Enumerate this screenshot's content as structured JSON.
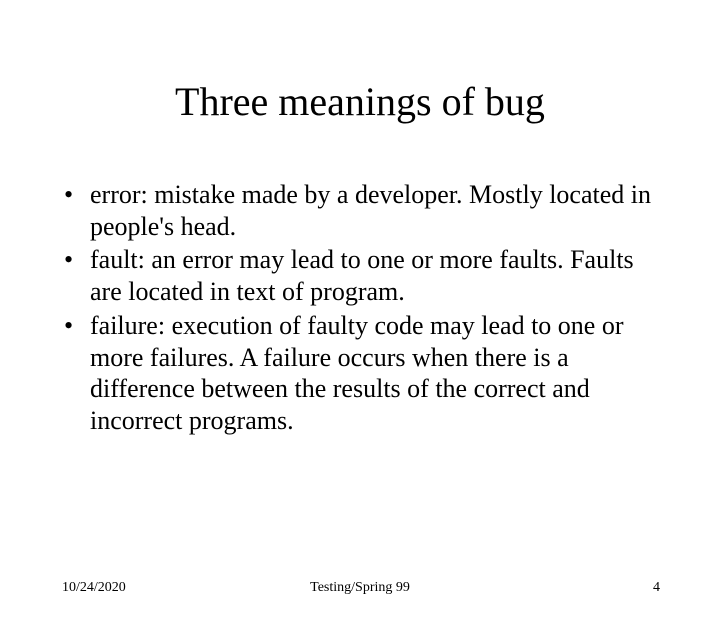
{
  "title": "Three meanings of bug",
  "bullets": [
    "error: mistake made by a developer. Mostly located in people's head.",
    "fault: an error may lead to one or more faults. Faults are located in text of program.",
    "failure: execution of faulty code may lead to one or more failures. A failure occurs when there is a difference between the results of the correct and incorrect programs."
  ],
  "footer": {
    "date": "10/24/2020",
    "center": "Testing/Spring 99",
    "page": "4"
  }
}
